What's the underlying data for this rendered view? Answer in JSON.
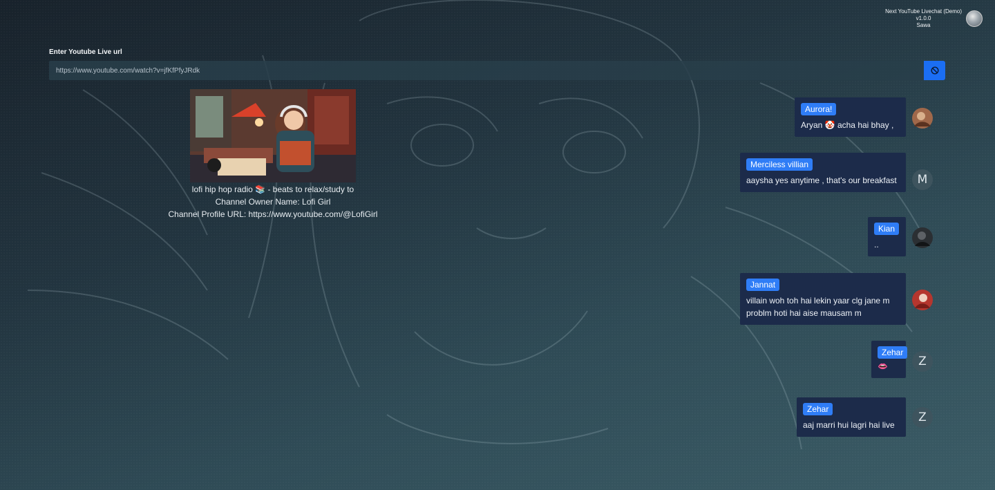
{
  "app": {
    "title": "Next YouTube Livechat (Demo)",
    "version": "v1.0.0",
    "user": "Sawa"
  },
  "url_form": {
    "label": "Enter Youtube Live url",
    "value": "https://www.youtube.com/watch?v=jfKfPfyJRdk",
    "button_icon": "ban-icon",
    "accent": "#1b6ef3"
  },
  "video": {
    "title": "lofi hip hop radio 📚 - beats to relax/study to",
    "owner": "Channel Owner Name: Lofi Girl",
    "profile_url": "Channel Profile URL: https://www.youtube.com/@LofiGirl"
  },
  "chat": [
    {
      "author": "Aurora!",
      "text": "Aryan 🤡 acha hai bhay ,",
      "avatar": "photo"
    },
    {
      "author": "Merciless villian",
      "text": "aaysha yes anytime , that's our breakfast",
      "avatar": "M"
    },
    {
      "author": "Kian",
      "text": "..",
      "avatar": "photo"
    },
    {
      "author": "Jannat",
      "text": "villain woh toh hai lekin yaar clg jane m problm hoti hai aise mausam m",
      "avatar": "photo"
    },
    {
      "author": "Zehar",
      "text": "👄",
      "avatar": "Z"
    },
    {
      "author": "Zehar",
      "text": "aaj marri hui lagri hai live",
      "avatar": "Z"
    }
  ]
}
